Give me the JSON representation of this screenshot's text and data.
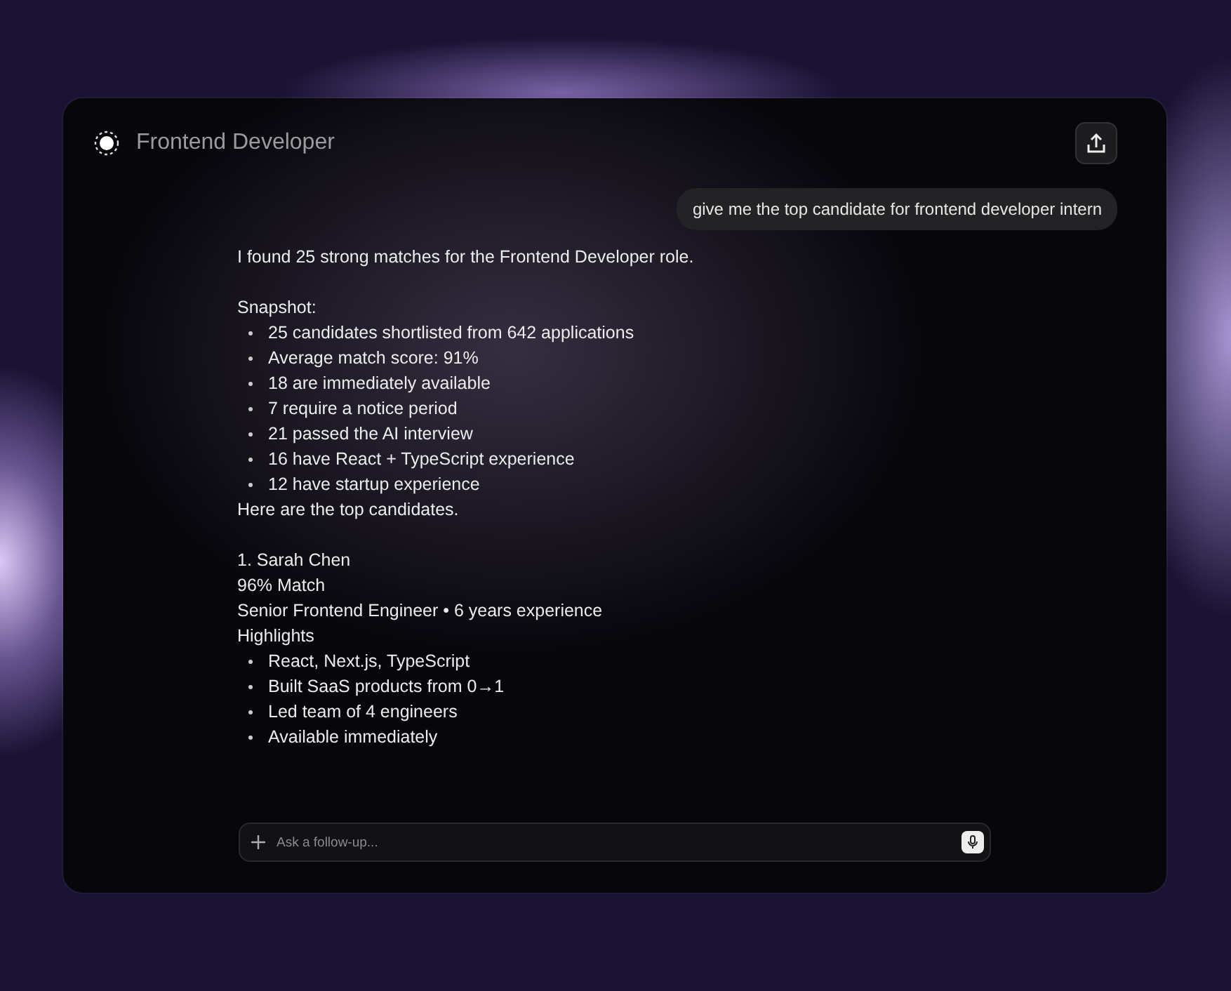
{
  "header": {
    "title": "Frontend Developer"
  },
  "user_message": "give me the top candidate for frontend developer intern",
  "reply": {
    "intro": "I found 25 strong matches for the Frontend Developer role.",
    "snapshot_label": "Snapshot:",
    "snapshot_items": [
      "25 candidates shortlisted from 642 applications",
      "Average match score: 91%",
      "18 are immediately available",
      "7 require a notice period",
      "21 passed the AI interview",
      "16 have React + TypeScript experience",
      "12 have startup experience"
    ],
    "outro": "Here are the top candidates.",
    "candidate": {
      "name": "1. Sarah Chen",
      "match": "96% Match",
      "role": "Senior Frontend Engineer • 6 years experience",
      "highlights_label": "Highlights",
      "highlights": [
        "React, Next.js, TypeScript",
        "Built SaaS products from 0→1",
        "Led team of 4 engineers",
        "Available immediately"
      ]
    }
  },
  "composer": {
    "placeholder": "Ask a follow-up..."
  }
}
